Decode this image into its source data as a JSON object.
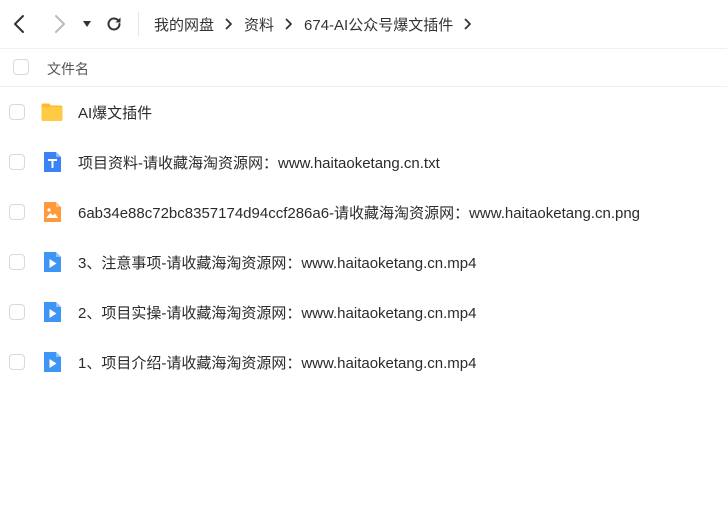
{
  "toolbar": {
    "back_icon": "chevron-left-icon",
    "forward_icon": "chevron-right-icon",
    "dropdown_icon": "caret-down-icon",
    "refresh_icon": "refresh-icon"
  },
  "breadcrumb": {
    "items": [
      {
        "label": "我的网盘"
      },
      {
        "label": "资料"
      },
      {
        "label": "674-AI公众号爆文插件"
      }
    ],
    "separator_icon": "chevron-right-icon"
  },
  "list_header": {
    "name_column": "文件名"
  },
  "files": [
    {
      "name": "AI爆文插件",
      "type": "folder",
      "icon": "folder-icon"
    },
    {
      "name": "项目资料-请收藏海淘资源网：www.haitaoketang.cn.txt",
      "type": "txt",
      "icon": "text-file-icon"
    },
    {
      "name": "6ab34e88c72bc8357174d94ccf286a6-请收藏海淘资源网：www.haitaoketang.cn.png",
      "type": "png",
      "icon": "image-file-icon"
    },
    {
      "name": "3、注意事项-请收藏海淘资源网：www.haitaoketang.cn.mp4",
      "type": "mp4",
      "icon": "video-file-icon"
    },
    {
      "name": "2、项目实操-请收藏海淘资源网：www.haitaoketang.cn.mp4",
      "type": "mp4",
      "icon": "video-file-icon"
    },
    {
      "name": "1、项目介绍-请收藏海淘资源网：www.haitaoketang.cn.mp4",
      "type": "mp4",
      "icon": "video-file-icon"
    }
  ],
  "colors": {
    "folder": "#FFC53D",
    "txt": "#3B82F6",
    "png": "#FF9A3C",
    "video": "#3D95F5"
  }
}
